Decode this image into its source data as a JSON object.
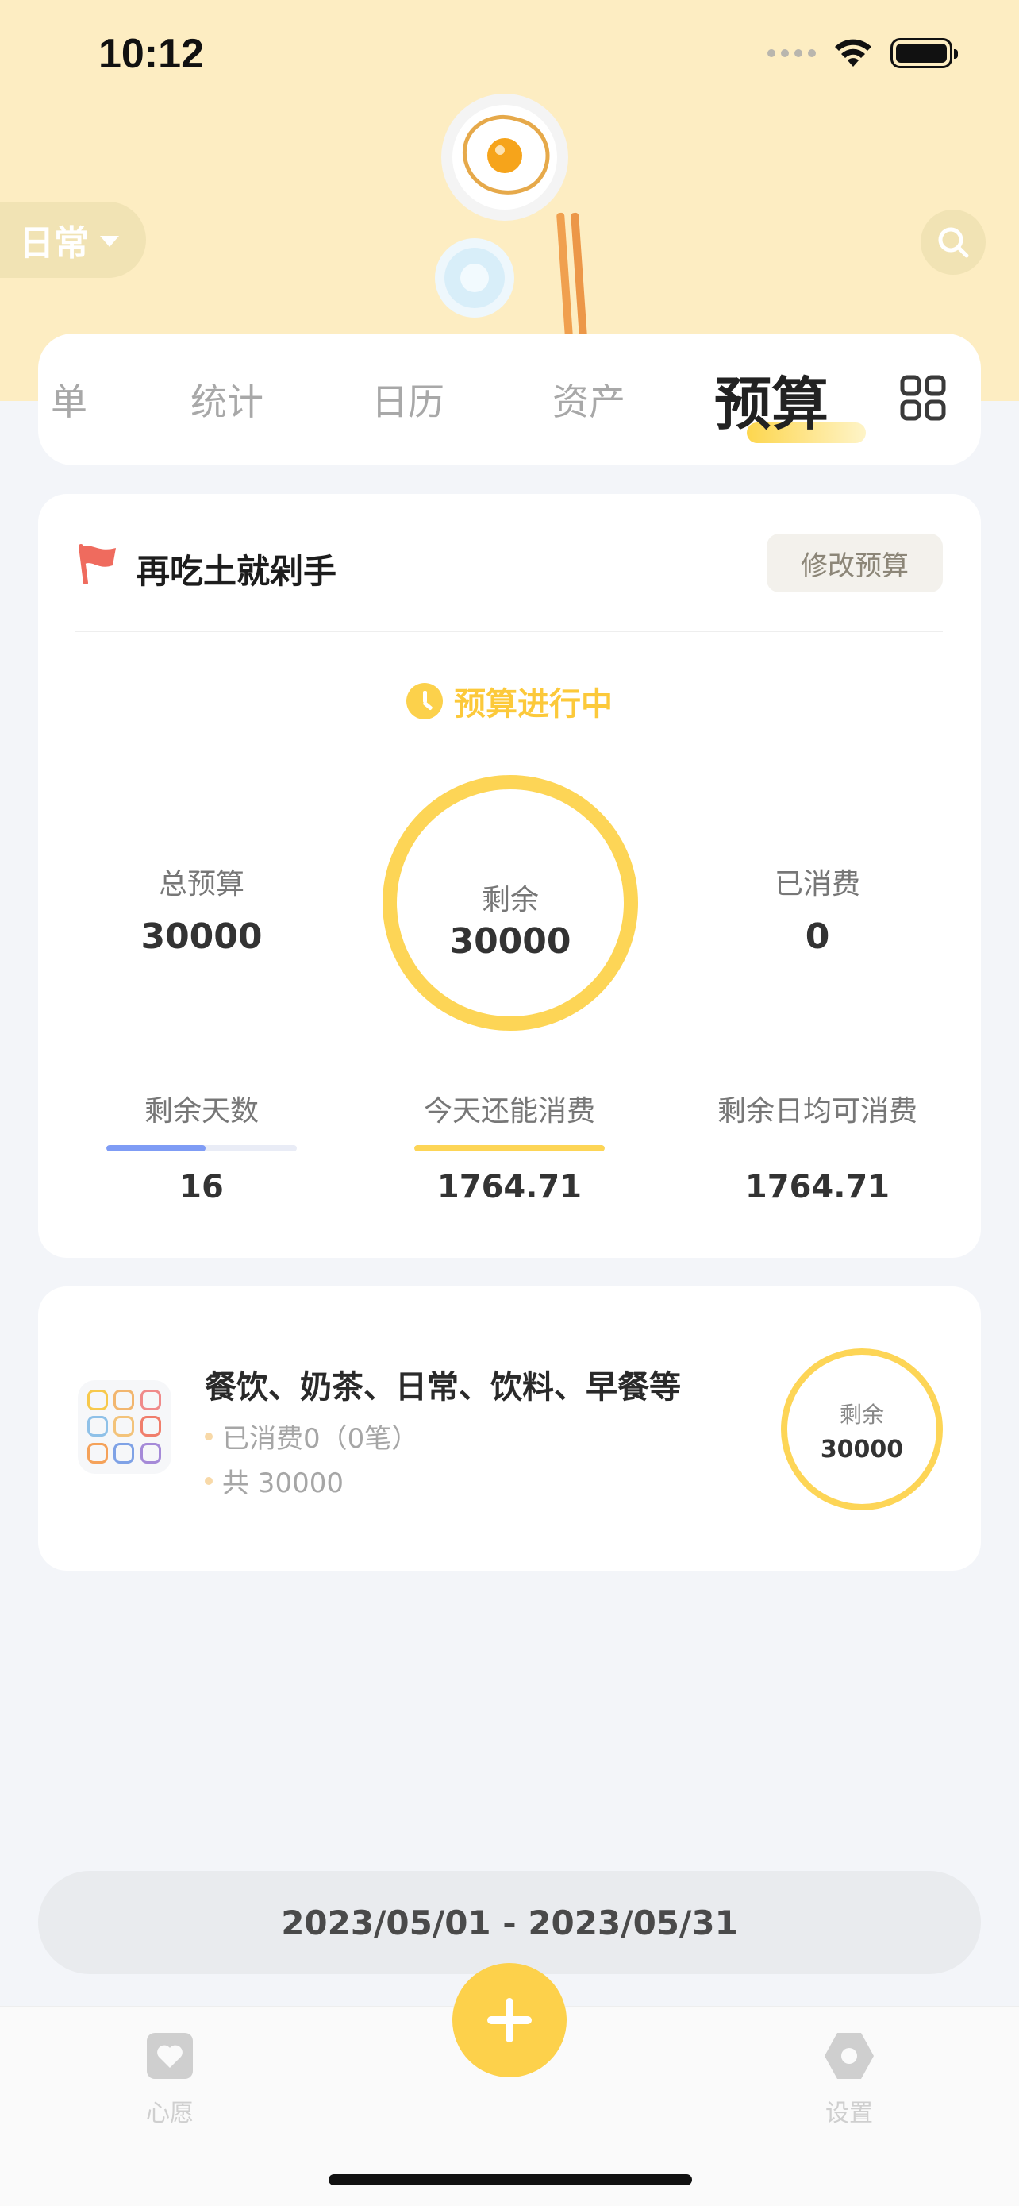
{
  "status_bar": {
    "time": "10:12"
  },
  "header": {
    "book_name": "日常"
  },
  "tabs": [
    {
      "label": "单"
    },
    {
      "label": "统计"
    },
    {
      "label": "日历"
    },
    {
      "label": "资产"
    },
    {
      "label": "预算"
    }
  ],
  "budget": {
    "name": "再吃土就剁手",
    "edit_label": "修改预算",
    "status": "预算进行中",
    "total_label": "总预算",
    "total_value": "30000",
    "remaining_label": "剩余",
    "remaining_value": "30000",
    "spent_label": "已消费",
    "spent_value": "0",
    "days_left_label": "剩余天数",
    "days_left_value": "16",
    "days_left_progress": 0.52,
    "today_label": "今天还能消费",
    "today_value": "1764.71",
    "today_progress": 1.0,
    "daily_label": "剩余日均可消费",
    "daily_value": "1764.71"
  },
  "category": {
    "title": "餐饮、奶茶、日常、饮料、早餐等",
    "spent_text": "已消费0（0笔）",
    "total_text": "共 30000",
    "remaining_label": "剩余",
    "remaining_value": "30000"
  },
  "date_range": "2023/05/01 - 2023/05/31",
  "bottom_nav": {
    "wish_label": "心愿",
    "settings_label": "设置"
  },
  "colors": {
    "accent": "#fdd556",
    "header_bg": "#fdedc2",
    "progress_blue": "#7f9cf5"
  }
}
